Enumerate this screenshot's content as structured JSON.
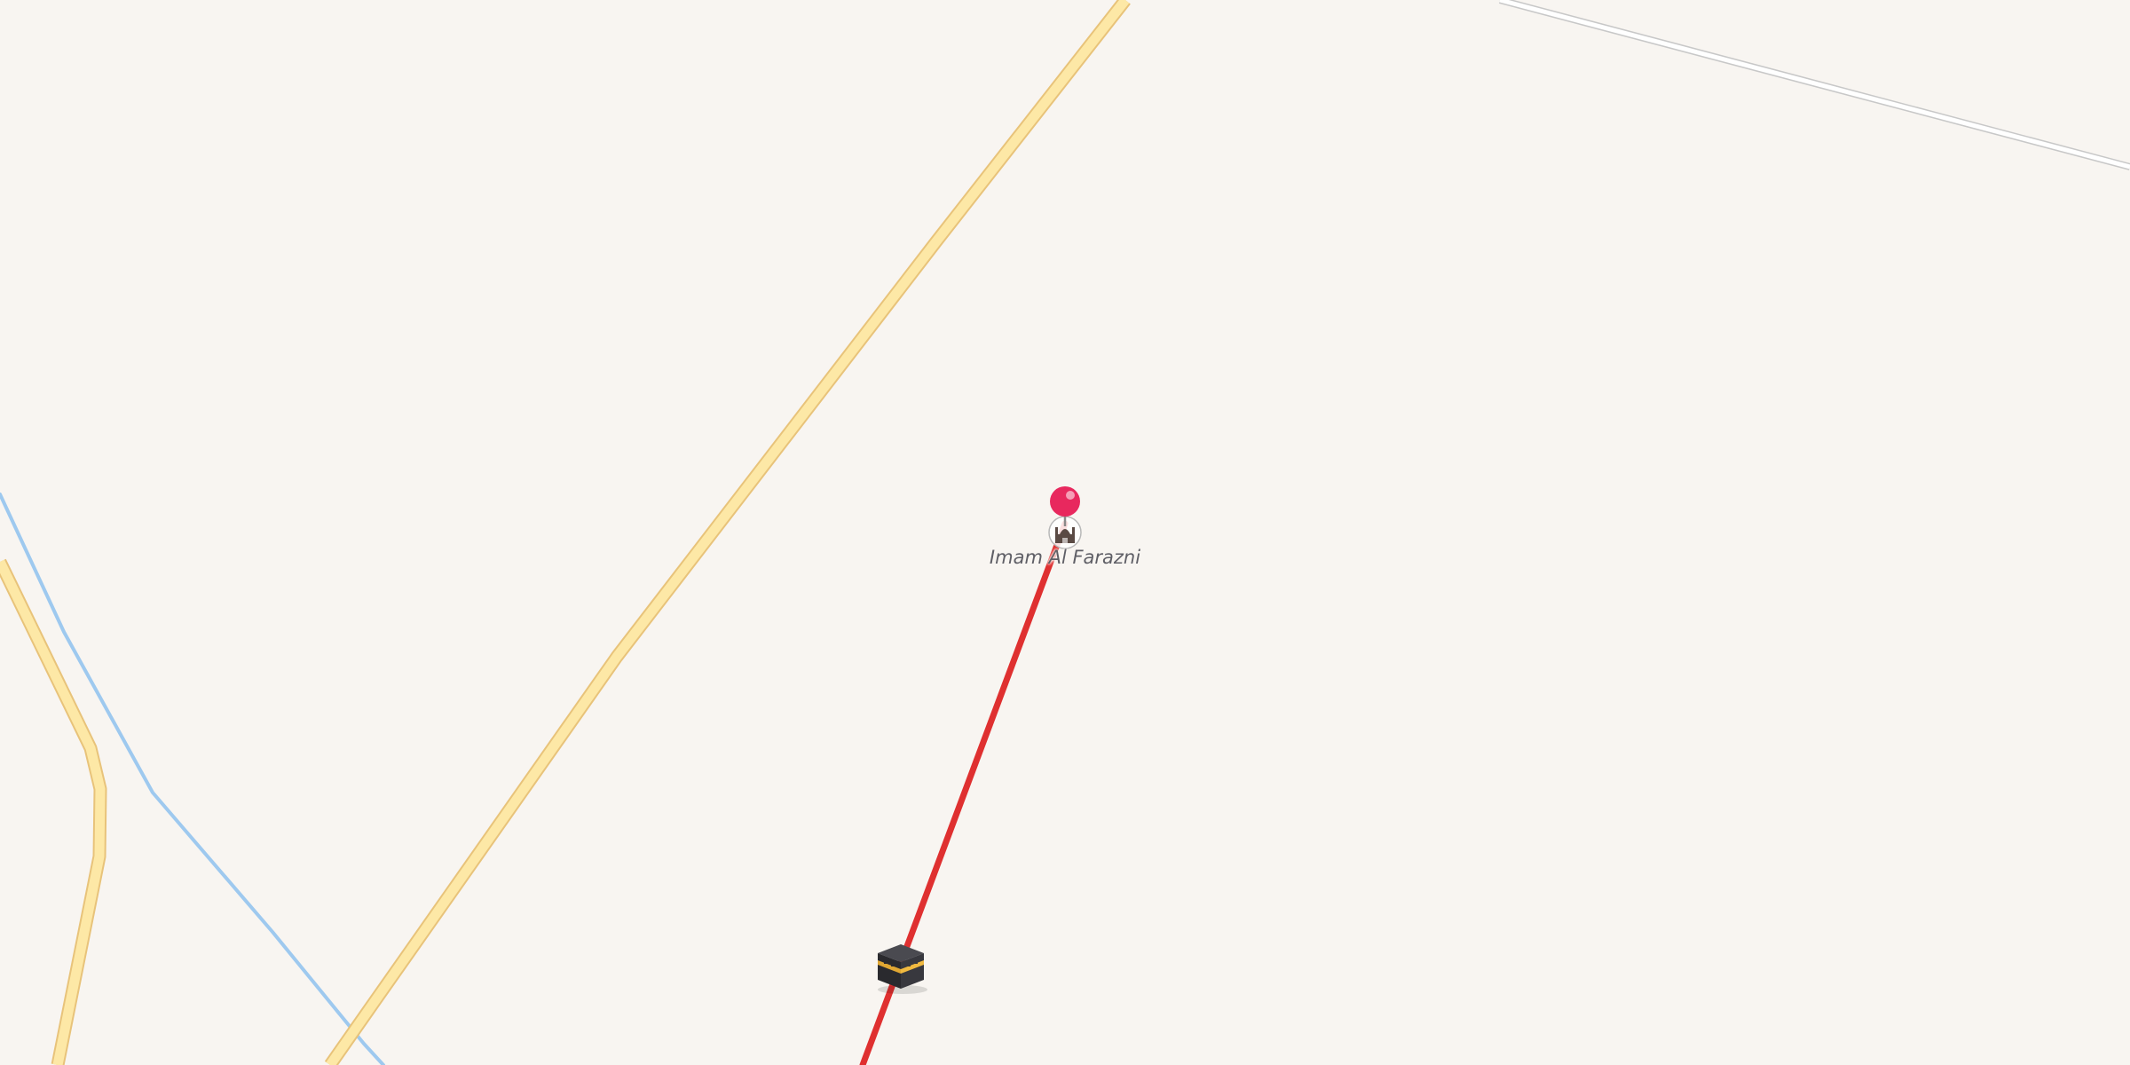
{
  "map": {
    "background_color": "#f8f5f1",
    "poi": {
      "name": "Imam Al Farazni",
      "icon": "mosque-icon"
    },
    "markers": [
      {
        "icon": "map-pin-icon",
        "color": "#e8285e"
      },
      {
        "icon": "kaaba-icon",
        "color": "#2a2a2e"
      }
    ],
    "route": {
      "color": "#df3030"
    },
    "road_colors": {
      "main_fill": "#fde8a6",
      "main_casing": "#e8c37a",
      "minor_fill": "#ffffff",
      "minor_casing": "#c8c8c8"
    },
    "waterway_color": "#9ec9ef"
  }
}
